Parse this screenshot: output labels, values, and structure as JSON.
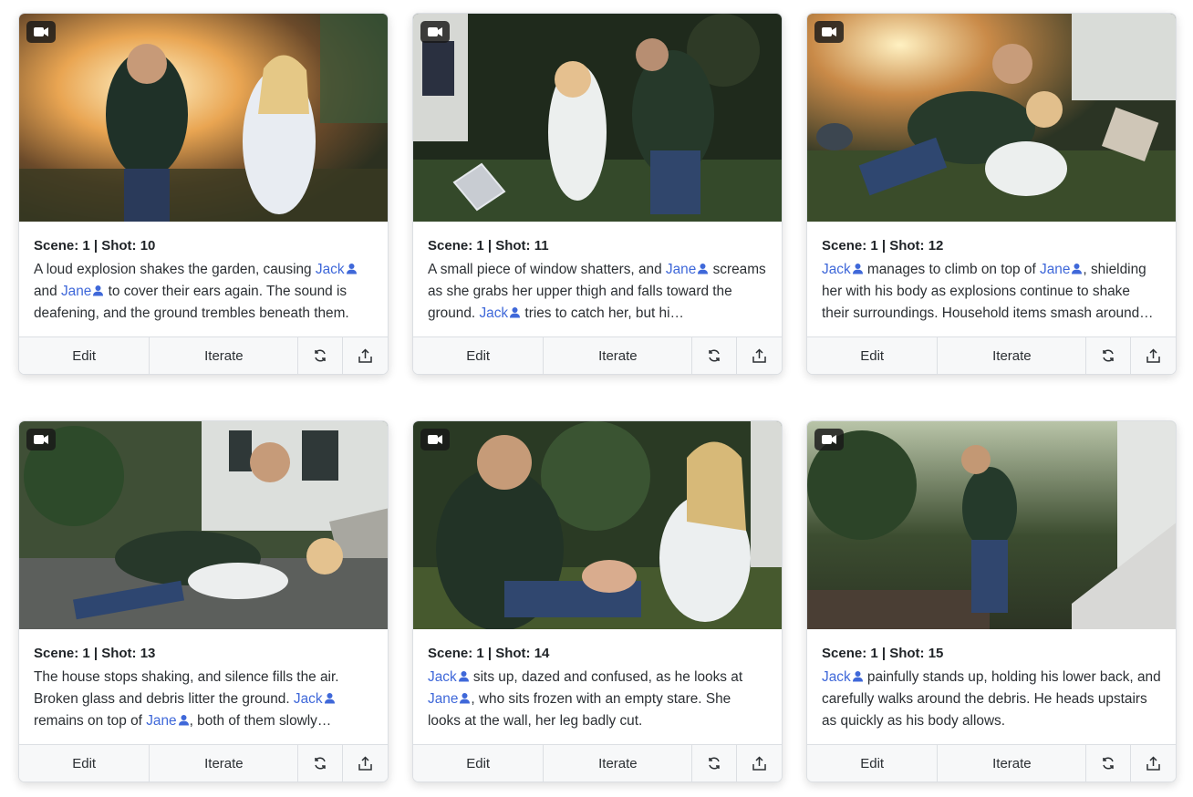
{
  "cards": [
    {
      "scene_label": "Scene: 1 | Shot: 10",
      "segments": [
        {
          "t": "A loud explosion shakes the garden, causing "
        },
        {
          "c": "Jack"
        },
        {
          "t": " and "
        },
        {
          "c": "Jane"
        },
        {
          "t": " to cover their ears again. The sound is deafening, and the ground trembles beneath them."
        }
      ]
    },
    {
      "scene_label": "Scene: 1 | Shot: 11",
      "segments": [
        {
          "t": "A small piece of window shatters, and "
        },
        {
          "c": "Jane"
        },
        {
          "t": " screams as she grabs her upper thigh and falls toward the ground. "
        },
        {
          "c": "Jack"
        },
        {
          "t": " tries to catch her, but hi…"
        }
      ]
    },
    {
      "scene_label": "Scene: 1 | Shot: 12",
      "segments": [
        {
          "c": "Jack"
        },
        {
          "t": " manages to climb on top of "
        },
        {
          "c": "Jane"
        },
        {
          "t": ", shielding her with his body as explosions continue to shake their surroundings. Household items smash around…"
        }
      ]
    },
    {
      "scene_label": "Scene: 1 | Shot: 13",
      "segments": [
        {
          "t": "The house stops shaking, and silence fills the air. Broken glass and debris litter the ground. "
        },
        {
          "c": "Jack"
        },
        {
          "t": " remains on top of "
        },
        {
          "c": "Jane"
        },
        {
          "t": ", both of them slowly…"
        }
      ]
    },
    {
      "scene_label": "Scene: 1 | Shot: 14",
      "segments": [
        {
          "c": "Jack"
        },
        {
          "t": " sits up, dazed and confused, as he looks at "
        },
        {
          "c": "Jane"
        },
        {
          "t": ", who sits frozen with an empty stare. She looks at the wall, her leg badly cut."
        }
      ]
    },
    {
      "scene_label": "Scene: 1 | Shot: 15",
      "segments": [
        {
          "c": "Jack"
        },
        {
          "t": " painfully stands up, holding his lower back, and carefully walks around the debris. He heads upstairs as quickly as his body allows."
        }
      ]
    }
  ],
  "actions": {
    "edit_label": "Edit",
    "iterate_label": "Iterate",
    "regenerate_icon": "refresh-icon",
    "export_icon": "share-icon"
  },
  "colors": {
    "character_link": "#3f68d9",
    "border": "#dcdfe3",
    "footer_bg": "#f7f8f9"
  }
}
